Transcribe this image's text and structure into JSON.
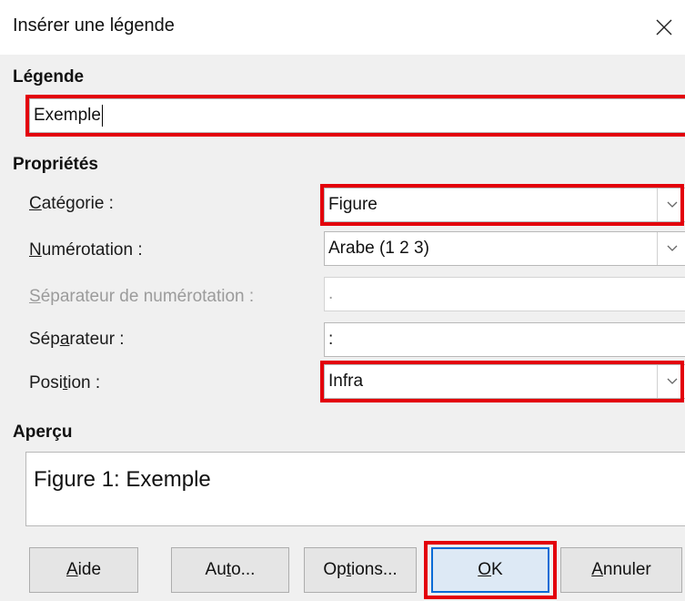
{
  "dialog": {
    "title": "Insérer une légende"
  },
  "caption": {
    "heading": "Légende",
    "value": "Exemple"
  },
  "properties": {
    "heading": "Propriétés",
    "category": {
      "label_underlined": "C",
      "label_rest": "atégorie :",
      "value": "Figure"
    },
    "numbering": {
      "label_underlined": "N",
      "label_rest": "umérotation :",
      "value": "Arabe (1 2 3)"
    },
    "numbering_separator": {
      "label_underlined": "S",
      "label_rest": "éparateur de numérotation :",
      "value": "."
    },
    "separator": {
      "label_before": "Sép",
      "label_underlined": "a",
      "label_rest": "rateur :",
      "value": ":"
    },
    "position": {
      "label_before": "Posi",
      "label_underlined": "t",
      "label_rest": "ion :",
      "value": "Infra"
    }
  },
  "preview": {
    "heading": "Aperçu",
    "text": "Figure 1: Exemple"
  },
  "buttons": {
    "help": {
      "underlined": "A",
      "rest": "ide"
    },
    "auto": {
      "before": "Au",
      "underlined": "t",
      "rest": "o..."
    },
    "options": {
      "before": "Op",
      "underlined": "t",
      "rest": "ions..."
    },
    "ok": {
      "underlined": "O",
      "rest": "K"
    },
    "cancel": {
      "underlined": "A",
      "rest": "nnuler"
    }
  },
  "colors": {
    "highlight": "#e3000b",
    "default_button_border": "#0a6bd6",
    "dialog_background": "#f0f0f0"
  },
  "icons": {
    "close": "close-icon",
    "dropdown": "chevron-down-icon"
  }
}
